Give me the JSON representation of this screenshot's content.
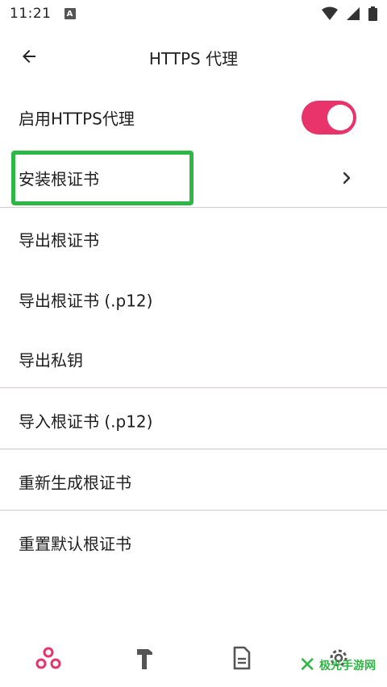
{
  "status_bar": {
    "time": "11:21",
    "notification_icon": "A"
  },
  "app_bar": {
    "title": "HTTPS 代理"
  },
  "settings": [
    {
      "label": "启用HTTPS代理",
      "control": "toggle",
      "toggle_on": true
    },
    {
      "label": "安装根证书",
      "control": "chevron"
    },
    {
      "label": "导出根证书"
    },
    {
      "label": "导出根证书 (.p12)"
    },
    {
      "label": "导出私钥"
    },
    {
      "label": "导入根证书 (.p12)"
    },
    {
      "label": "重新生成根证书"
    },
    {
      "label": "重置默认根证书"
    }
  ],
  "accent_color": "#e8336b",
  "highlight_color": "#2db745",
  "bottom_nav": [
    {
      "icon": "network-nodes-icon",
      "active": true
    },
    {
      "icon": "hammer-icon",
      "active": false
    },
    {
      "icon": "document-icon",
      "active": false
    },
    {
      "icon": "gear-icon",
      "active": false
    }
  ],
  "watermark": {
    "text": "极光手游网"
  }
}
